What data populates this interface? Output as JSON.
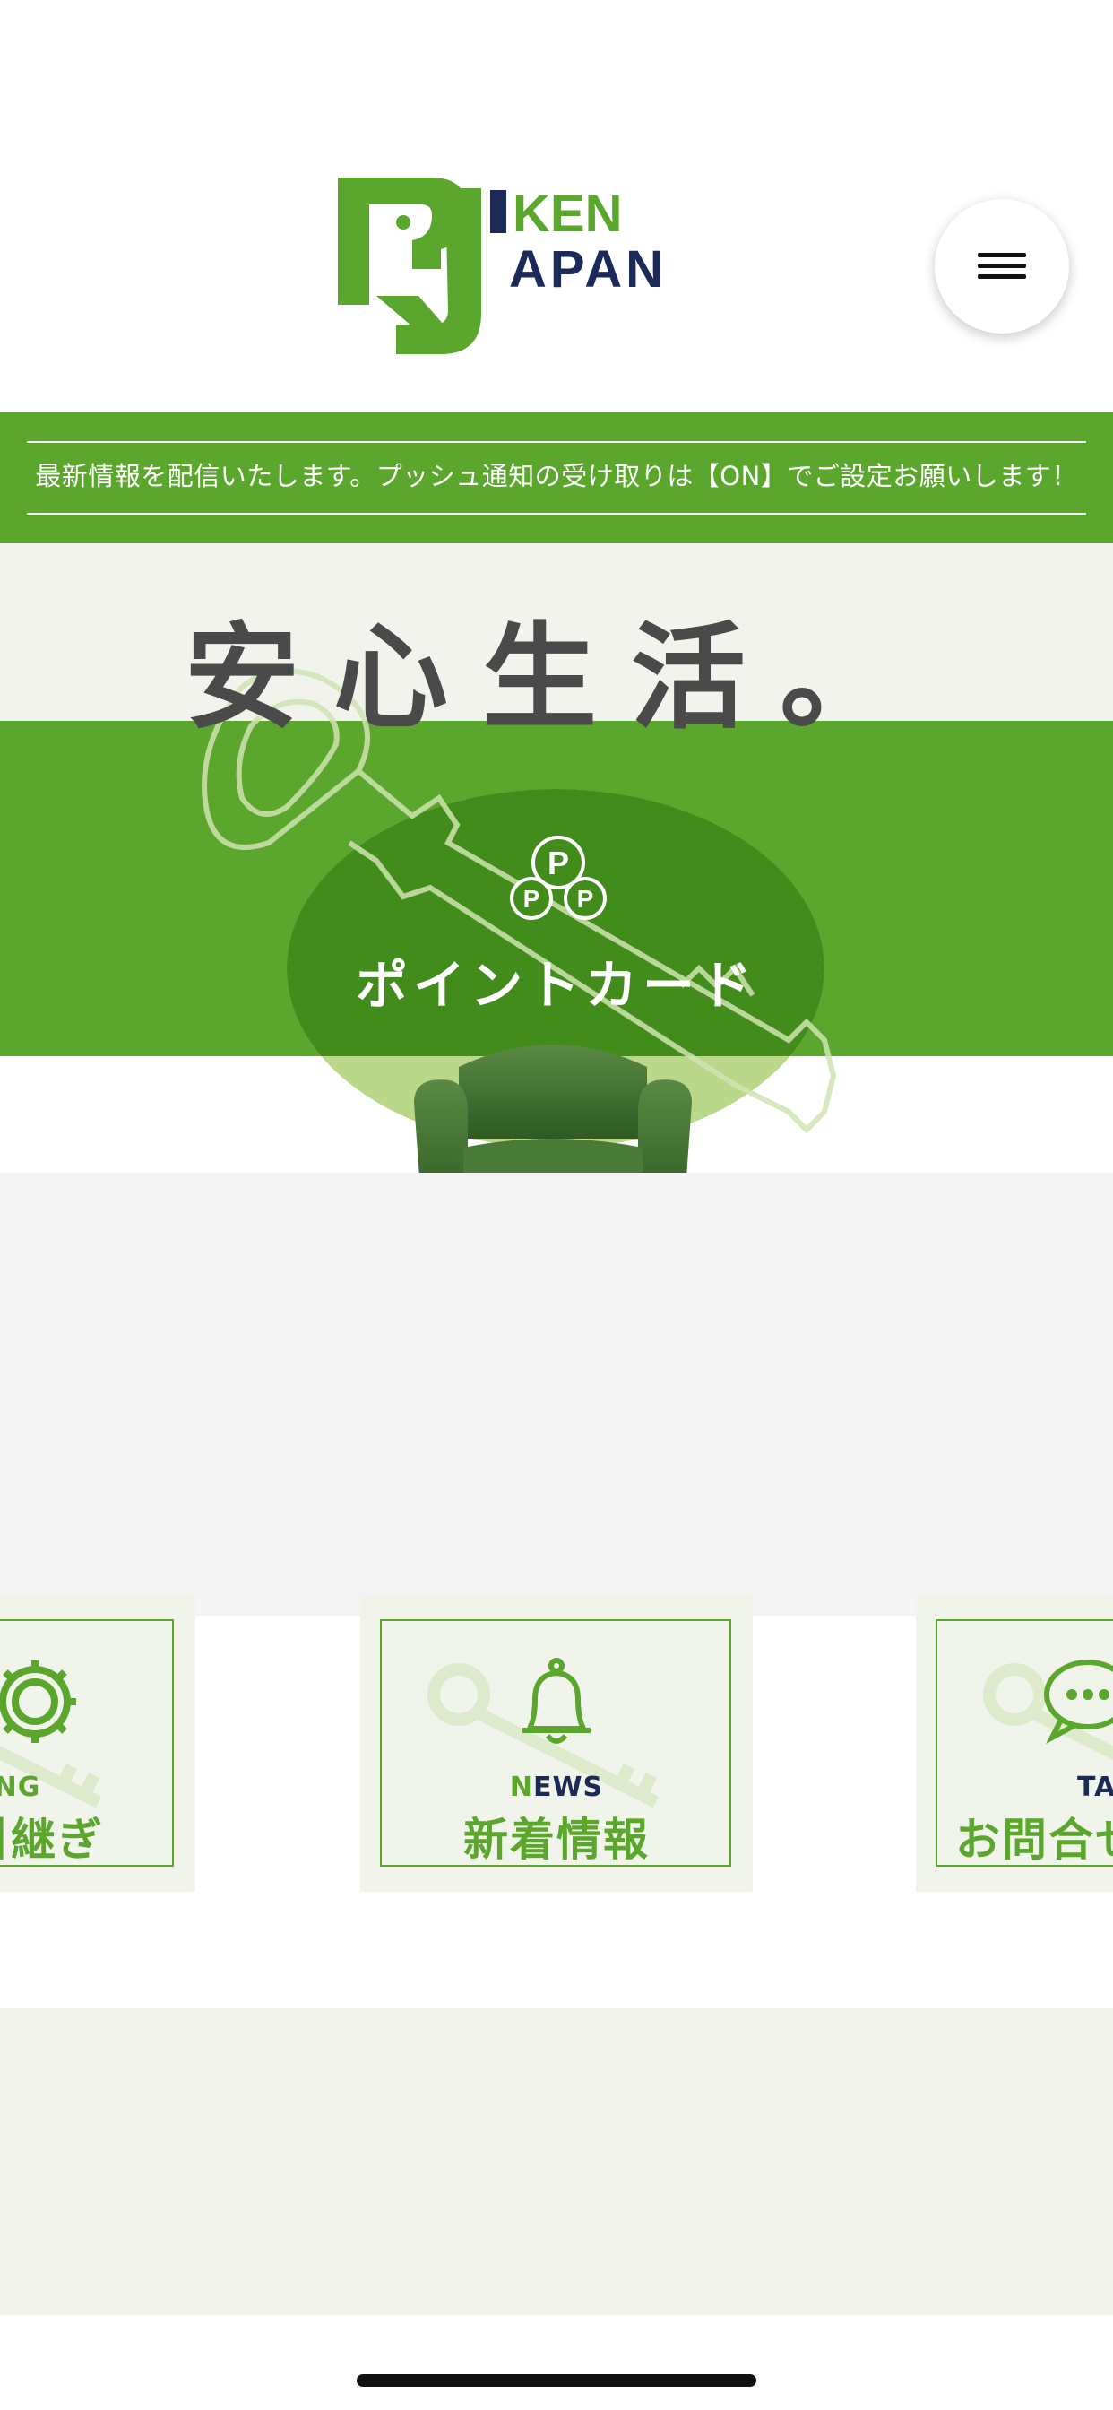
{
  "header": {
    "logo_text_top": "KEN",
    "logo_text_bottom": "APAN",
    "menu_icon": "hamburger-menu-icon"
  },
  "notice": {
    "text": "最新情報を配信いたします。プッシュ通知の受け取りは【ON】でご設定お願いします！"
  },
  "hero": {
    "title": "安心生活。",
    "point_icon_letter": "P",
    "point_card_label": "ポイントカード"
  },
  "carousel": {
    "cards": [
      {
        "en_accent": "TING",
        "en_rest": "",
        "jp": "引継ぎ",
        "icon": "gear-icon"
      },
      {
        "en_accent": "N",
        "en_rest": "EWS",
        "jp": "新着情報",
        "icon": "bell-icon"
      },
      {
        "en_accent": "",
        "en_rest": "TA",
        "jp": "お問合せ",
        "icon": "chat-bubble-icon"
      }
    ]
  },
  "colors": {
    "brand_green": "#5ba62d",
    "dark_green": "#428c1b",
    "navy": "#1b2a57"
  }
}
